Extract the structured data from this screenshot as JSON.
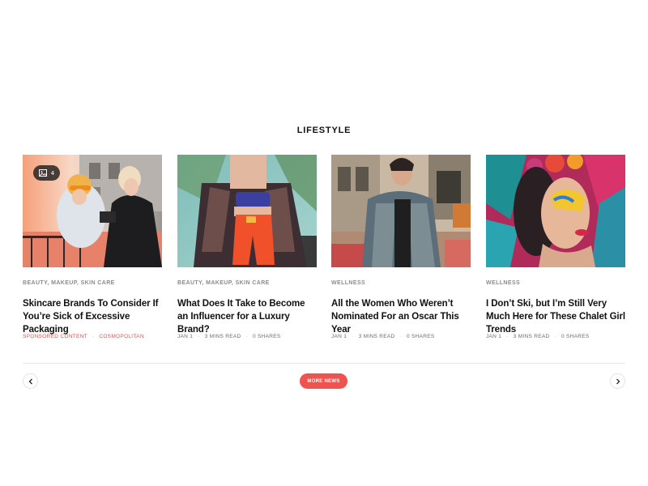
{
  "section": {
    "title": "LIFESTYLE"
  },
  "cards": [
    {
      "image_desc": "two-people-street-photo",
      "gallery_count": "4",
      "category": "BEAUTY, MAKEUP, SKIN CARE",
      "title": "Skincare Brands To Consider If You’re Sick of Excessive Packaging",
      "meta": [
        "SPONSORED CONTENT",
        "COSMOPOLITAN"
      ]
    },
    {
      "image_desc": "woman-orange-shorts-photo",
      "category": "BEAUTY, MAKEUP, SKIN CARE",
      "title": "What Does It Take to Become an Influencer for a Luxury Brand?",
      "meta": [
        "JAN 1",
        "3 MINS READ",
        "0 SHARES"
      ]
    },
    {
      "image_desc": "man-plaid-suit-photo",
      "category": "WELLNESS",
      "title": "All the Women Who Weren’t Nominated For an Oscar This Year",
      "meta": [
        "JAN 1",
        "3 MINS READ",
        "0 SHARES"
      ]
    },
    {
      "image_desc": "colorful-makeup-portrait-photo",
      "category": "WELLNESS",
      "title": "I Don’t Ski, but I’m Still Very Much Here for These Chalet Girl Trends",
      "meta": [
        "JAN 1",
        "3 MINS READ",
        "0 SHARES"
      ]
    }
  ],
  "pagination": {
    "more_label": "MORE NEWS"
  },
  "colors": {
    "accent": "#f0524f",
    "text": "#111111",
    "muted": "#8c8c8c"
  }
}
